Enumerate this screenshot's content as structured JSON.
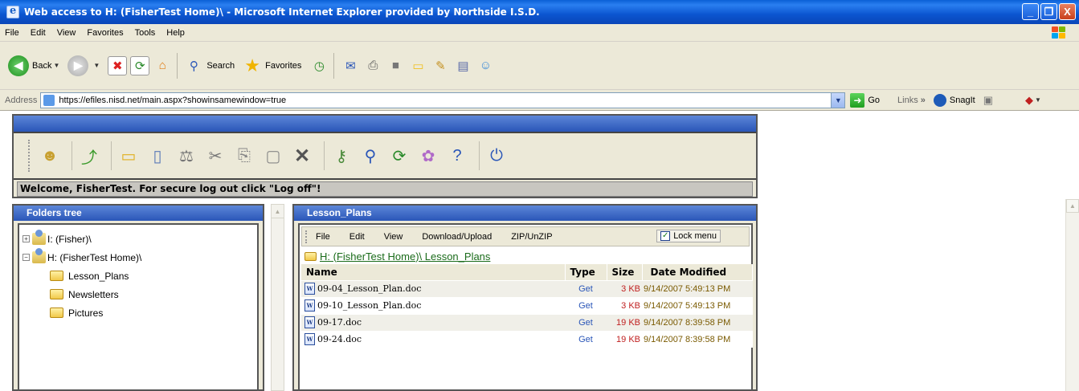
{
  "window": {
    "title": "Web access to H: (FisherTest Home)\\  - Microsoft Internet Explorer provided by Northside I.S.D.",
    "minimize": "_",
    "maximize": "❐",
    "close": "X"
  },
  "menu": [
    "File",
    "Edit",
    "View",
    "Favorites",
    "Tools",
    "Help"
  ],
  "toolbar": {
    "back_label": "Back",
    "search_label": "Search",
    "favorites_label": "Favorites",
    "icons": [
      "back-icon",
      "forward-icon",
      "stop-icon",
      "refresh-icon",
      "home-icon",
      "search-icon",
      "favorites-star-icon",
      "history-icon",
      "mail-icon",
      "print-icon",
      "edit-icon",
      "folder-icon",
      "messenger-icon",
      "research-icon",
      "contacts-icon"
    ]
  },
  "address": {
    "label": "Address",
    "url": "https://efiles.nisd.net/main.aspx?showinsamewindow=true",
    "go_label": "Go",
    "links_label": "Links",
    "chevron": "»",
    "snagit_label": "SnagIt"
  },
  "app": {
    "welcome": "Welcome, FisherTest. For secure log out click \"Log off\"!",
    "icons": [
      "home-user-icon",
      "up-folder-icon",
      "new-folder-icon",
      "new-file-icon",
      "compare-icon",
      "cut-icon",
      "copy-icon",
      "paste-icon",
      "delete-icon",
      "permissions-icon",
      "search-icon",
      "refresh-icon",
      "skins-icon",
      "settings-icon",
      "help-icon",
      "power-icon"
    ]
  },
  "folders": {
    "title": "Folders tree",
    "drives": [
      {
        "label": "I: (Fisher)\\",
        "expander": "+"
      },
      {
        "label": "H: (FisherTest Home)\\",
        "expander": "−"
      }
    ],
    "subfolders": [
      "Lesson_Plans",
      "Newsletters",
      "Pictures"
    ]
  },
  "files": {
    "title": "Lesson_Plans",
    "menu": [
      "File",
      "Edit",
      "View",
      "Download/Upload",
      "ZIP/UnZIP"
    ],
    "lock_menu": "Lock menu",
    "lock_checked": "✓",
    "path": "H: (FisherTest Home)\\ Lesson_Plans",
    "columns": {
      "name": "Name",
      "type": "Type",
      "size": "Size",
      "date": "Date Modified"
    },
    "rows": [
      {
        "name": "09-04_Lesson_Plan.doc",
        "type": "Get",
        "size": "3 KB",
        "date": "9/14/2007 5:49:13 PM"
      },
      {
        "name": "09-10_Lesson_Plan.doc",
        "type": "Get",
        "size": "3 KB",
        "date": "9/14/2007 5:49:13 PM"
      },
      {
        "name": "09-17.doc",
        "type": "Get",
        "size": "19 KB",
        "date": "9/14/2007 8:39:58 PM"
      },
      {
        "name": "09-24.doc",
        "type": "Get",
        "size": "19 KB",
        "date": "9/14/2007 8:39:58 PM"
      }
    ]
  }
}
